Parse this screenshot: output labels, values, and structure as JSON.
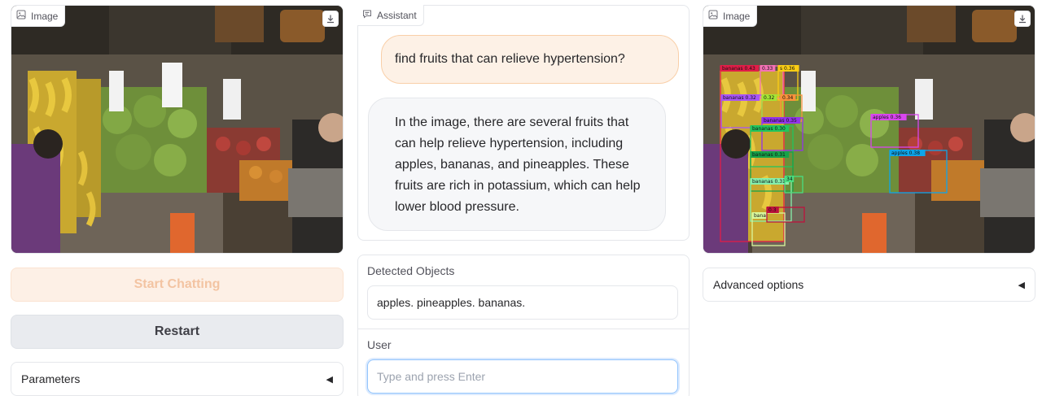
{
  "left_image": {
    "label": "Image"
  },
  "buttons": {
    "start_chatting": "Start Chatting",
    "restart": "Restart"
  },
  "parameters": {
    "label": "Parameters",
    "toggle": "◀"
  },
  "chat": {
    "label": "Assistant",
    "user_message": "find fruits that can relieve hypertension?",
    "assistant_message": "In the image, there are several fruits that can help relieve hypertension, including apples, bananas, and pineapples. These fruits are rich in potassium, which can help lower blood pressure."
  },
  "detected_objects": {
    "label": "Detected Objects",
    "value": "apples. pineapples. bananas."
  },
  "user_input": {
    "label": "User",
    "placeholder": "Type and press Enter",
    "value": ""
  },
  "right_image": {
    "label": "Image"
  },
  "advanced_options": {
    "label": "Advanced options",
    "toggle": "◀"
  },
  "detections": [
    {
      "label": "bananas 0.43",
      "color": "#e11d48"
    },
    {
      "label": "0.33",
      "color": "#f472b6"
    },
    {
      "label": "s 0.36",
      "color": "#facc15"
    },
    {
      "label": "bananas 0.32",
      "color": "#a855f7"
    },
    {
      "label": "0.32",
      "color": "#a3e635"
    },
    {
      "label": "0.34",
      "color": "#fb923c"
    },
    {
      "label": "bananas 0.35",
      "color": "#9333ea"
    },
    {
      "label": "bananas 0.30",
      "color": "#22c55e"
    },
    {
      "label": "bananas 0.31",
      "color": "#16a34a"
    },
    {
      "label": "apples 0.36",
      "color": "#d946ef"
    },
    {
      "label": "apples 0.38",
      "color": "#0ea5e9"
    },
    {
      "label": "bananas 0.31",
      "color": "#86efac"
    },
    {
      "label": "34",
      "color": "#4ade80"
    },
    {
      "label": "bana",
      "color": "#d9f99d"
    },
    {
      "label": "0.3",
      "color": "#be123c"
    }
  ]
}
